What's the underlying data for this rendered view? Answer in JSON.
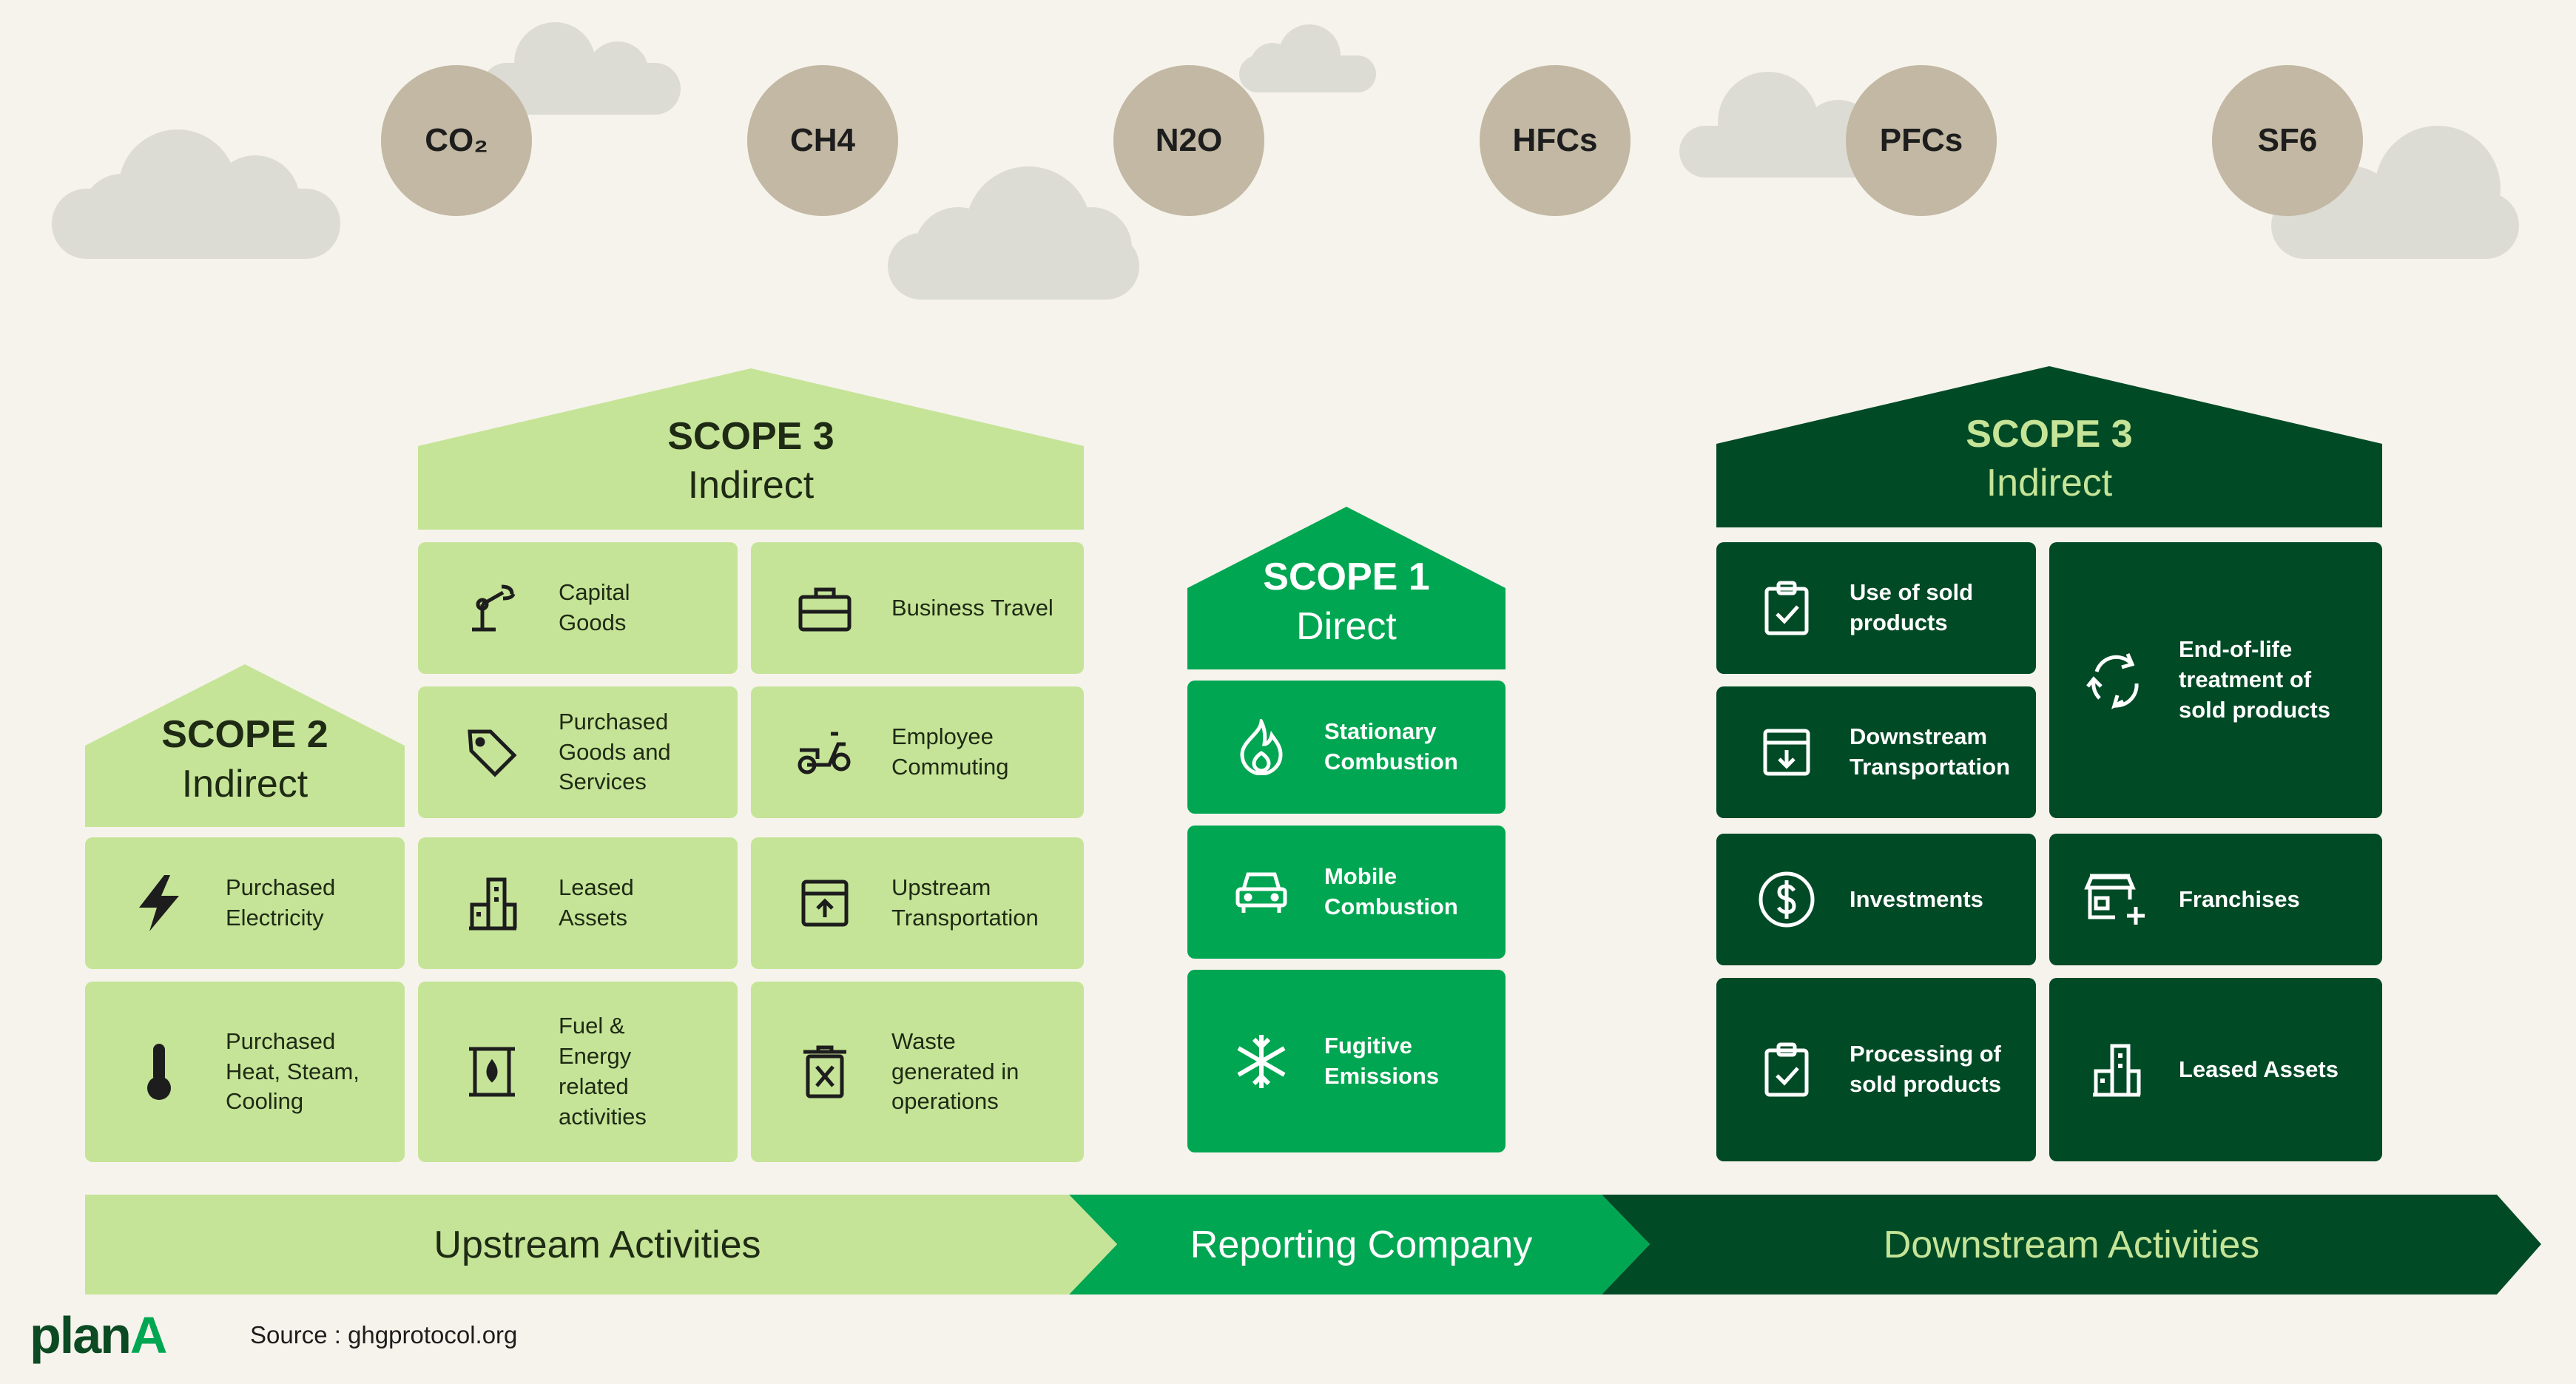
{
  "gases": [
    "CO₂",
    "CH4",
    "N2O",
    "HFCs",
    "PFCs",
    "SF6"
  ],
  "scope3_upstream": {
    "title": "SCOPE 3",
    "subtitle": "Indirect"
  },
  "scope2": {
    "title": "SCOPE 2",
    "subtitle": "Indirect"
  },
  "scope1": {
    "title": "SCOPE 1",
    "subtitle": "Direct"
  },
  "scope3_downstream": {
    "title": "SCOPE 3",
    "subtitle": "Indirect"
  },
  "scope2_items": [
    {
      "label": "Purchased\nElectricity",
      "icon": "lightning-icon"
    },
    {
      "label": "Purchased\nHeat, Steam,\nCooling",
      "icon": "thermometer-icon"
    }
  ],
  "scope3_up_items": [
    {
      "label": "Capital\nGoods",
      "icon": "robot-arm-icon"
    },
    {
      "label": "Business Travel",
      "icon": "briefcase-icon"
    },
    {
      "label": "Purchased\nGoods and\nServices",
      "icon": "tag-icon"
    },
    {
      "label": "Employee\nCommuting",
      "icon": "scooter-icon"
    },
    {
      "label": "Leased\nAssets",
      "icon": "building-icon"
    },
    {
      "label": "Upstream\nTransportation",
      "icon": "upload-box-icon"
    },
    {
      "label": "Fuel &\nEnergy\nrelated\nactivities",
      "icon": "fuel-barrel-icon"
    },
    {
      "label": "Waste\ngenerated in\noperations",
      "icon": "waste-bin-icon"
    }
  ],
  "scope1_items": [
    {
      "label": "Stationary\nCombustion",
      "icon": "flame-icon"
    },
    {
      "label": "Mobile\nCombustion",
      "icon": "car-icon"
    },
    {
      "label": "Fugitive\nEmissions",
      "icon": "snowflake-icon"
    }
  ],
  "scope3_down_items": [
    {
      "label": "Use of sold\nproducts",
      "icon": "clipboard-check-icon"
    },
    {
      "label": "End-of-life\ntreatment of\nsold products",
      "icon": "recycle-icon"
    },
    {
      "label": "Downstream\nTransportation",
      "icon": "download-box-icon"
    },
    {
      "label": "Investments",
      "icon": "dollar-icon"
    },
    {
      "label": "Franchises",
      "icon": "store-plus-icon"
    },
    {
      "label": "Processing of\nsold products",
      "icon": "clipboard-check-icon"
    },
    {
      "label": "Leased Assets",
      "icon": "building-icon"
    }
  ],
  "bars": {
    "upstream": "Upstream Activities",
    "reporting": "Reporting Company",
    "downstream": "Downstream Activities"
  },
  "logo": {
    "part1": "plan",
    "part2": "A"
  },
  "source": "Source : ghgprotocol.org",
  "colors": {
    "light": "#c5e497",
    "mid": "#00a651",
    "dark": "#004a26",
    "gas": "#c2b8a3",
    "cloud": "#dcdcd5",
    "background": "#f6f3ec"
  }
}
